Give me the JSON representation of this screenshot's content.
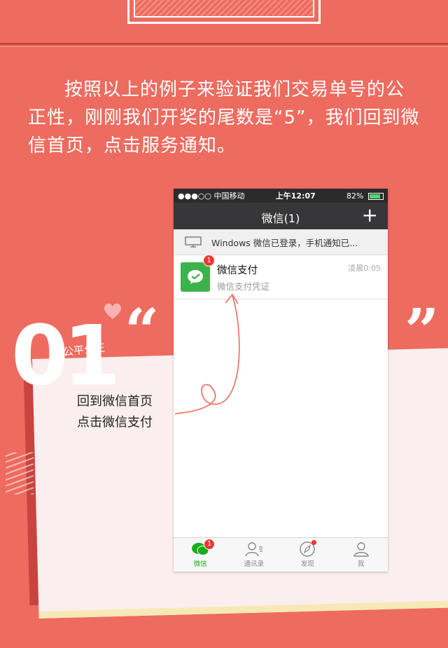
{
  "intro": {
    "line1": "按照以上的例子来验证我们交易单号的公正性，刚刚我们开奖的尾数是“5”，我们回到微信首页，点击服务通知。"
  },
  "tag": {
    "number": "01",
    "label": "公平公正"
  },
  "hint": {
    "line1": "回到微信首页",
    "line2": "点击微信支付"
  },
  "phone": {
    "status": {
      "carrier": "●●●○○ 中国移动",
      "time": "上午12:07",
      "battery": "82%"
    },
    "nav": {
      "title": "微信(1)",
      "plus": "+"
    },
    "notice": {
      "text": "Windows 微信已登录，手机通知已..."
    },
    "chat": {
      "name": "微信支付",
      "subtitle": "微信支付凭证",
      "time": "凌晨0:05",
      "badge": "1"
    },
    "tabs": [
      {
        "label": "微信",
        "icon": "chat-bubbles-icon",
        "badge": "1"
      },
      {
        "label": "通讯录",
        "icon": "contacts-icon"
      },
      {
        "label": "发现",
        "icon": "compass-icon"
      },
      {
        "label": "我",
        "icon": "person-icon"
      }
    ]
  },
  "colors": {
    "background": "#ee6b5f",
    "wechat_green": "#1aad19",
    "badge_red": "#f43530"
  }
}
